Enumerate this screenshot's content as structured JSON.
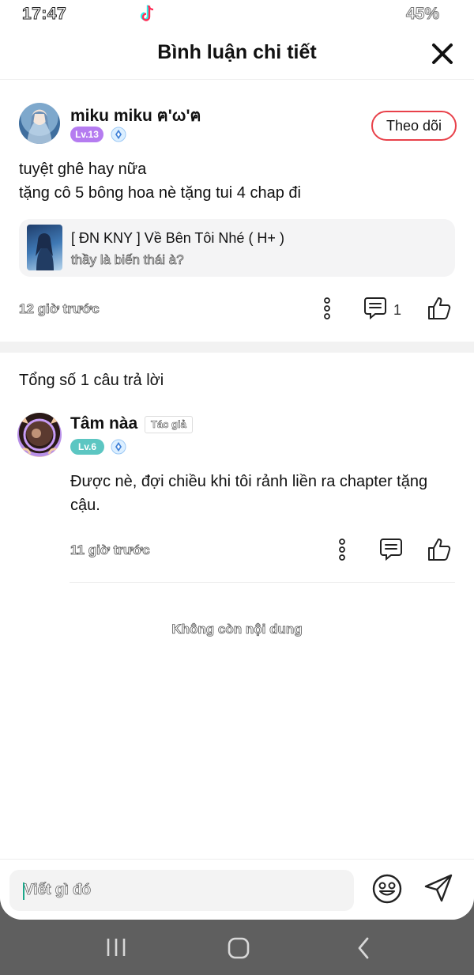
{
  "status": {
    "time": "17:47",
    "battery": "45%",
    "app_icon": "tiktok-icon"
  },
  "header": {
    "title": "Bình luận chi tiết",
    "close_icon": "close-icon"
  },
  "comment": {
    "username": "miku miku ฅ'ω'ฅ",
    "level": "Lv.13",
    "follow_label": "Theo dõi",
    "text_line1": "tuyệt ghê hay nữa",
    "text_line2": "tặng cô 5 bông hoa nè tặng tui 4 chap đi",
    "quote": {
      "title": "[ ĐN KNY ] Về Bên Tôi Nhé ( H+ )",
      "subtitle": "thầy là biến thái à?"
    },
    "time": "12 giờ trước",
    "reply_count": "1"
  },
  "replies": {
    "total_label": "Tổng số 1 câu trả lời",
    "items": [
      {
        "username": "Tâm nàa",
        "author_tag": "Tác giả",
        "level": "Lv.6",
        "text_line1": "Được nè, đợi chiều khi tôi rảnh liền ra chapter tặng",
        "text_line2": "cậu.",
        "time": "11 giờ trước"
      }
    ],
    "end_label": "Không còn nội dung"
  },
  "input": {
    "placeholder": "Viết gì đó"
  },
  "colors": {
    "accent": "#e8414a",
    "level_purple": "#b57cf0",
    "level_teal": "#5cc6c2"
  }
}
